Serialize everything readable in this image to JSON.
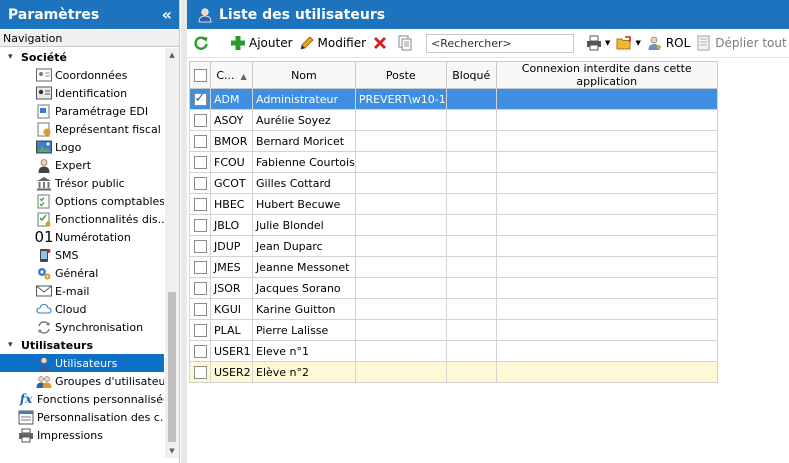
{
  "left_panel": {
    "title": "Paramètres",
    "collapse_glyph": "«",
    "nav_label": "Navigation",
    "sections": [
      {
        "label": "Société",
        "items": [
          {
            "label": "Coordonnées",
            "icon": "contact-card-icon"
          },
          {
            "label": "Identification",
            "icon": "id-card-icon"
          },
          {
            "label": "Paramétrage EDI",
            "icon": "edi-document-icon"
          },
          {
            "label": "Représentant fiscal",
            "icon": "fiscal-representative-icon"
          },
          {
            "label": "Logo",
            "icon": "image-icon"
          },
          {
            "label": "Expert",
            "icon": "expert-person-icon"
          },
          {
            "label": "Trésor public",
            "icon": "bank-building-icon"
          },
          {
            "label": "Options comptables",
            "icon": "accounting-checklist-icon"
          },
          {
            "label": "Fonctionnalités dis...",
            "icon": "features-checklist-icon"
          },
          {
            "label": "Numérotation",
            "icon": "numbering-icon",
            "glyph": "01"
          },
          {
            "label": "SMS",
            "icon": "mobile-sms-icon"
          },
          {
            "label": "Général",
            "icon": "gears-icon"
          },
          {
            "label": "E-mail",
            "icon": "envelope-icon"
          },
          {
            "label": "Cloud",
            "icon": "cloud-icon"
          },
          {
            "label": "Synchronisation",
            "icon": "sync-icon"
          }
        ]
      },
      {
        "label": "Utilisateurs",
        "items": [
          {
            "label": "Utilisateurs",
            "icon": "user-icon",
            "selected": true
          },
          {
            "label": "Groupes d'utilisateurs",
            "icon": "user-group-icon"
          }
        ]
      }
    ],
    "root_items": [
      {
        "label": "Fonctions personnalisées",
        "icon": "function-fx-icon",
        "glyph": "fx"
      },
      {
        "label": "Personnalisation des c...",
        "icon": "customization-icon"
      },
      {
        "label": "Impressions",
        "icon": "printer-icon"
      }
    ]
  },
  "right_panel": {
    "title": "Liste des utilisateurs",
    "toolbar": {
      "add_label": "Ajouter",
      "edit_label": "Modifier",
      "search_placeholder": "<Rechercher>",
      "rol_label": "ROL",
      "expand_all_label": "Déplier tout"
    },
    "grid": {
      "columns": [
        "C...",
        "Nom",
        "Poste",
        "Bloqué",
        "Connexion interdite dans cette application"
      ],
      "rows": [
        {
          "code": "ADM",
          "nom": "Administrateur",
          "poste": "PREVERT\\w10-1",
          "bloque": "",
          "connexion": "",
          "checked": true,
          "state": "selected"
        },
        {
          "code": "ASOY",
          "nom": "Aurélie Soyez",
          "poste": "",
          "bloque": "",
          "connexion": "",
          "checked": false,
          "state": ""
        },
        {
          "code": "BMOR",
          "nom": "Bernard Moricet",
          "poste": "",
          "bloque": "",
          "connexion": "",
          "checked": false,
          "state": ""
        },
        {
          "code": "FCOU",
          "nom": "Fabienne Courtois",
          "poste": "",
          "bloque": "",
          "connexion": "",
          "checked": false,
          "state": ""
        },
        {
          "code": "GCOT",
          "nom": "Gilles Cottard",
          "poste": "",
          "bloque": "",
          "connexion": "",
          "checked": false,
          "state": ""
        },
        {
          "code": "HBEC",
          "nom": "Hubert Becuwe",
          "poste": "",
          "bloque": "",
          "connexion": "",
          "checked": false,
          "state": ""
        },
        {
          "code": "JBLO",
          "nom": "Julie Blondel",
          "poste": "",
          "bloque": "",
          "connexion": "",
          "checked": false,
          "state": ""
        },
        {
          "code": "JDUP",
          "nom": "Jean Duparc",
          "poste": "",
          "bloque": "",
          "connexion": "",
          "checked": false,
          "state": ""
        },
        {
          "code": "JMES",
          "nom": "Jeanne Messonet",
          "poste": "",
          "bloque": "",
          "connexion": "",
          "checked": false,
          "state": ""
        },
        {
          "code": "JSOR",
          "nom": "Jacques Sorano",
          "poste": "",
          "bloque": "",
          "connexion": "",
          "checked": false,
          "state": ""
        },
        {
          "code": "KGUI",
          "nom": "Karine Guitton",
          "poste": "",
          "bloque": "",
          "connexion": "",
          "checked": false,
          "state": ""
        },
        {
          "code": "PLAL",
          "nom": "Pierre Lalisse",
          "poste": "",
          "bloque": "",
          "connexion": "",
          "checked": false,
          "state": ""
        },
        {
          "code": "USER1",
          "nom": "Eleve n°1",
          "poste": "",
          "bloque": "",
          "connexion": "",
          "checked": false,
          "state": ""
        },
        {
          "code": "USER2",
          "nom": "Elève n°2",
          "poste": "",
          "bloque": "",
          "connexion": "",
          "checked": false,
          "state": "new"
        }
      ]
    }
  },
  "colors": {
    "header_blue": "#1e73be",
    "selected_row": "#3e8fe0",
    "new_row_yellow": "#fdf9d6",
    "tree_selected": "#0f70c8"
  }
}
